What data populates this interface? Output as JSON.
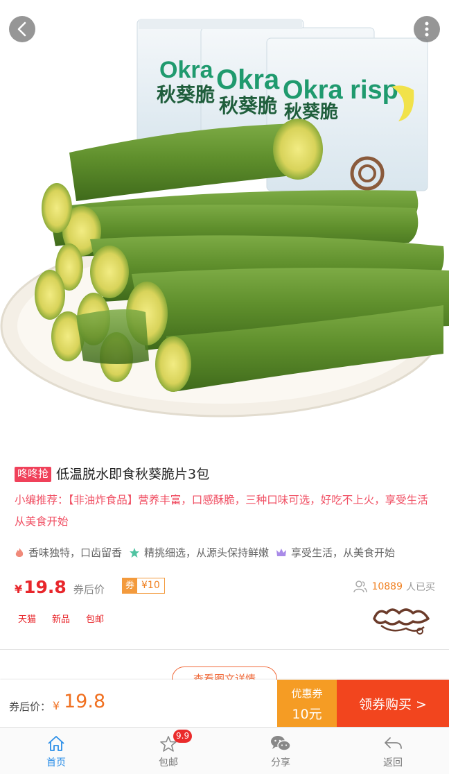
{
  "product": {
    "promo_tag": "咚咚抢",
    "title": "低温脱水即食秋葵脆片3包",
    "recommend_prefix": "小编推荐：",
    "recommend_text": "【非油炸食品】营养丰富，口感酥脆，三种口味可选，好吃不上火，享受生活从美食开始",
    "features": [
      {
        "icon": "flame-icon",
        "text": "香味独特，口齿留香",
        "color": "#f08a7a"
      },
      {
        "icon": "star-icon",
        "text": "精挑细选，从源头保持鲜嫩",
        "color": "#4fc3a1"
      },
      {
        "icon": "crown-icon",
        "text": "享受生活，从美食开始",
        "color": "#a98be8"
      }
    ],
    "price_symbol": "¥",
    "price": "19.8",
    "price_label": "券后价",
    "coupon_tag": "券",
    "coupon_value": "¥10",
    "buyers_count": "10889",
    "buyers_unit": "人已买",
    "tags": [
      "天猫",
      "新品",
      "包邮"
    ],
    "brand_logo": "brand-logo",
    "packaging_text_1": "Okra",
    "packaging_text_2": "Okra",
    "packaging_text_3": "Okra risp",
    "packaging_cn": "秋葵脆"
  },
  "detail_button": "查看图文详情",
  "buybar": {
    "after_label": "券后价：",
    "after_symbol": "¥",
    "after_price": "19.8",
    "coupon_line1": "优惠券",
    "coupon_line2": "10元",
    "buy_label": "领券购买 >"
  },
  "tabbar": {
    "items": [
      {
        "label": "首页",
        "icon": "home-icon",
        "active": true
      },
      {
        "label": "包邮",
        "icon": "star-icon",
        "badge": "9.9"
      },
      {
        "label": "分享",
        "icon": "wechat-icon"
      },
      {
        "label": "返回",
        "icon": "return-icon"
      }
    ]
  },
  "colors": {
    "accent_red": "#e8262b",
    "orange": "#f59c24",
    "buy_red": "#f2451e",
    "active_blue": "#2a8ee8"
  }
}
